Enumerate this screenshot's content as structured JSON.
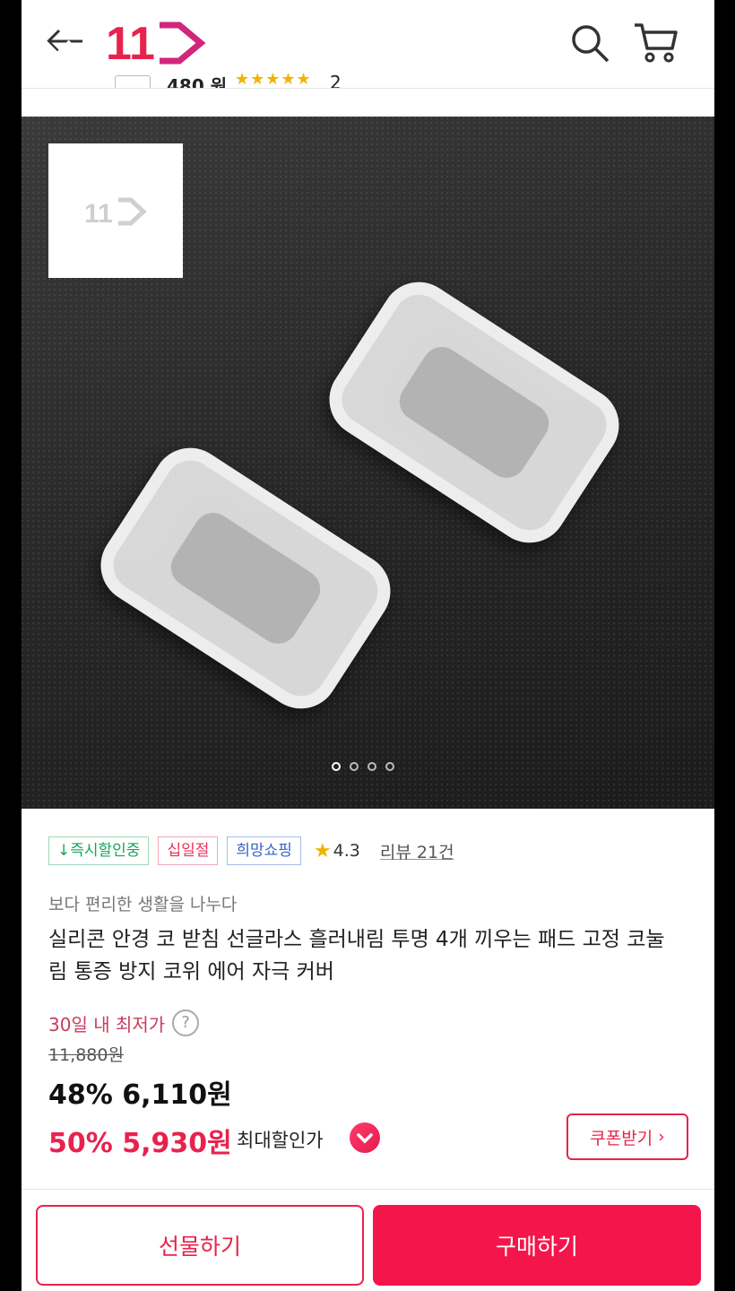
{
  "header": {
    "logo_text": "11",
    "icons": [
      "back-arrow-icon",
      "close-icon",
      "search-icon",
      "cart-icon"
    ]
  },
  "colors": {
    "brand_red": "#e8224d",
    "badge_green": "#17a35b",
    "badge_blue": "#3a63c7",
    "star": "#f0b400"
  },
  "gallery": {
    "total_images": 4,
    "active_index": 0
  },
  "badges": [
    {
      "label": "↓즉시할인중"
    },
    {
      "label": "십일절"
    },
    {
      "label": "희망쇼핑"
    }
  ],
  "rating": {
    "score": "4.3",
    "reviews": "리뷰 21건"
  },
  "product": {
    "subtitle": "보다 편리한 생활을 나누다",
    "title": "실리콘 안경 코 받침 선글라스 흘러내림 투명 4개 끼우는 패드 고정 코눌림 통증 방지 코위 에어 자극 커버"
  },
  "pricing": {
    "lowest_30d_label": "30일 내 최저가",
    "original_price": "11,880원",
    "discount_rate": "48%",
    "sale_price": "6,110원",
    "max_discount_rate": "50%",
    "max_discount_price": "5,930원",
    "max_discount_label": "최대할인가",
    "coupon_button": "쿠폰받기"
  },
  "footer": {
    "gift_button": "선물하기",
    "buy_button": "구매하기"
  }
}
